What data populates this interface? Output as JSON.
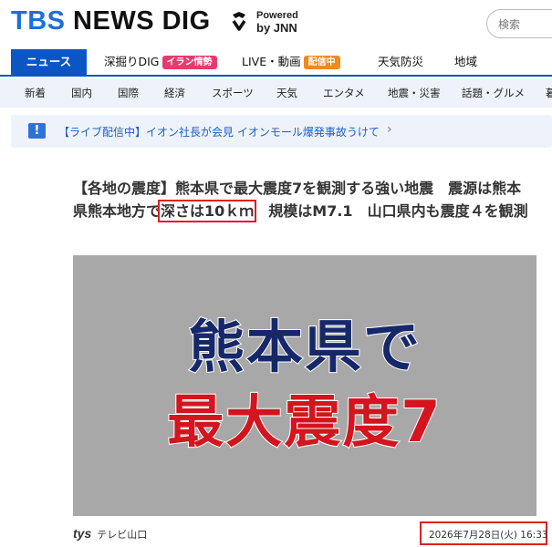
{
  "header": {
    "logo_tbs": "TBS",
    "logo_rest": " NEWS DIG",
    "powered_line1": "Powered",
    "powered_line2": "by JNN",
    "search_placeholder": "検索"
  },
  "main_nav": [
    {
      "label": "ニュース",
      "active": true
    },
    {
      "label": "深掘りDIG",
      "badge": "イラン情勢",
      "badge_color": "#e63a6f"
    },
    {
      "label": "LIVE・動画",
      "badge": "配信中",
      "badge_color": "#f08a1c"
    },
    {
      "label": "天気防災"
    },
    {
      "label": "地域"
    }
  ],
  "sub_nav": [
    "新着",
    "国内",
    "国際",
    "経済",
    "スポーツ",
    "天気",
    "エンタメ",
    "地震・災害",
    "話題・グルメ",
    "暮"
  ],
  "alert": {
    "icon": "!",
    "text": "【ライブ配信中】イオン社長が会見 イオンモール爆発事故うけて",
    "chevron": "›"
  },
  "article": {
    "headline_part1": "【各地の震度】熊本県で最大震度7を観測する強い地震　震源は熊本県熊本地方で",
    "headline_highlight": "深さは10ｋｍ",
    "headline_part2": "　規模はM7.1　山口県内も震度４を観測",
    "image_line1": "熊本県で",
    "image_line2": "最大震度7",
    "source_logo": "tys",
    "source_name": "テレビ山口",
    "date": "2026年7月28日(火) 16:33"
  },
  "colors": {
    "brand_blue": "#0a56c4",
    "highlight_red": "#e01f1f"
  }
}
